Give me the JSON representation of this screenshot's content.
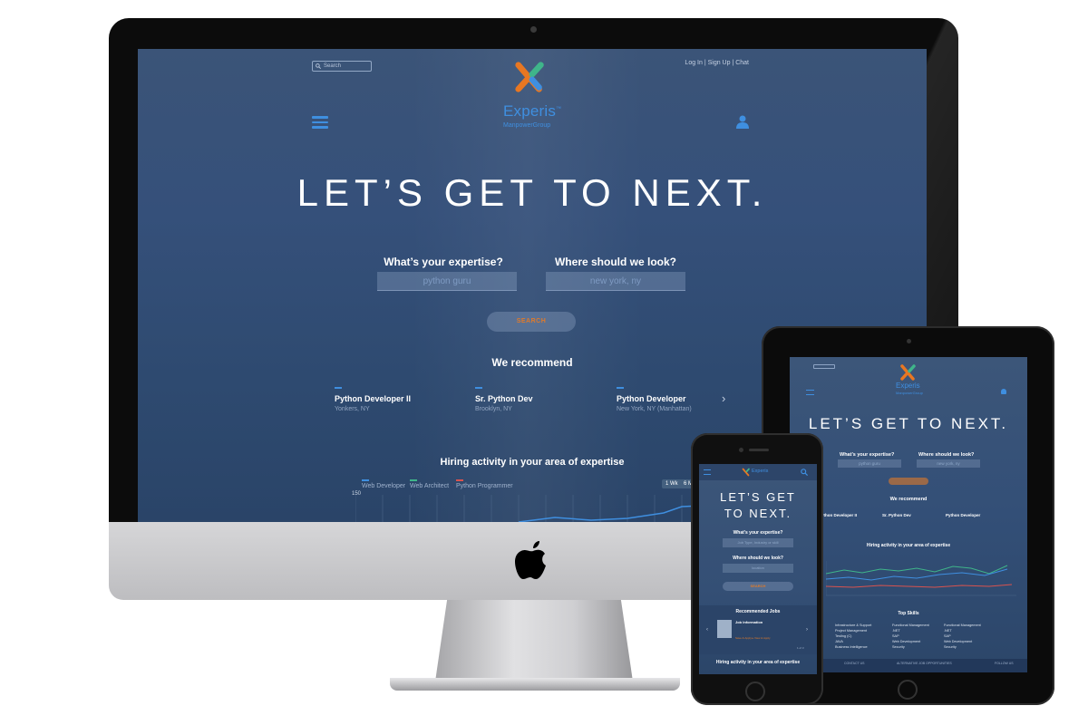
{
  "brand": {
    "name": "Experis",
    "tm": "™",
    "sub": "ManpowerGroup",
    "colors": {
      "orange": "#e87722",
      "blue": "#3f8fe0",
      "bg": "#354f77"
    }
  },
  "desktop": {
    "search_placeholder": "Search",
    "top_links": "Log In | Sign Up | Chat",
    "hero": "LET’S GET TO NEXT.",
    "expertise_label": "What’s your expertise?",
    "expertise_placeholder": "python guru",
    "location_label": "Where should we look?",
    "location_placeholder": "new york, ny",
    "search_button": "SEARCH",
    "recommend_title": "We recommend",
    "recommendations": [
      {
        "title": "Python Developer II",
        "location": "Yonkers, NY"
      },
      {
        "title": "Sr. Python Dev",
        "location": "Brooklyn, NY"
      },
      {
        "title": "Python Developer",
        "location": "New York, NY (Manhattan)"
      }
    ],
    "hiring_title": "Hiring activity in your area of expertise",
    "legend": [
      {
        "name": "Web Developer",
        "color": "#3f8fe0"
      },
      {
        "name": "Web Architect",
        "color": "#3fb58a"
      },
      {
        "name": "Python Programmer",
        "color": "#d9534f"
      }
    ],
    "ranges": [
      "1 Wk",
      "6 Mo"
    ],
    "y_top": "150"
  },
  "tablet": {
    "hero": "LET’S GET TO NEXT.",
    "expertise_label": "What’s your expertise?",
    "expertise_placeholder": "python guru",
    "location_label": "Where should we look?",
    "location_placeholder": "new york, ny",
    "recommend_title": "We recommend",
    "recommendations": [
      {
        "title": "Python Developer II",
        "location": "Yonkers, NY"
      },
      {
        "title": "Sr. Python Dev",
        "location": "Brooklyn, NY"
      },
      {
        "title": "Python Developer",
        "location": "New York, NY (Manhattan)"
      }
    ],
    "hiring_title": "Hiring activity in your area of expertise",
    "top_skills_title": "Top Skills",
    "skills": [
      [
        "Infrastructure & Support",
        "Project Management",
        "Testing (C)",
        "JAVA",
        "Business Intelligence"
      ],
      [
        "Functional Management",
        ".NET",
        "SAP",
        "Web Development",
        "Security"
      ],
      [
        "Functional Management",
        ".NET",
        "SAP",
        "Web Development",
        "Security"
      ]
    ],
    "footer": [
      "CONTACT US",
      "ALTERNATIVE JOB OPPORTUNITIES",
      "FOLLOW US"
    ]
  },
  "phone": {
    "hero": "LET’S GET TO NEXT.",
    "expertise_label": "What’s your expertise?",
    "expertise_placeholder": "Job Type, Industry or skill",
    "location_label": "Where should we look?",
    "location_placeholder": "location",
    "search_button": "SEARCH",
    "recommended_title": "Recommended Jobs",
    "job_title": "Job Information",
    "job_link": "Save & Apply ▸ View & Apply",
    "pager": "1 of 3",
    "hiring_title": "Hiring activity in your area of expertise"
  }
}
